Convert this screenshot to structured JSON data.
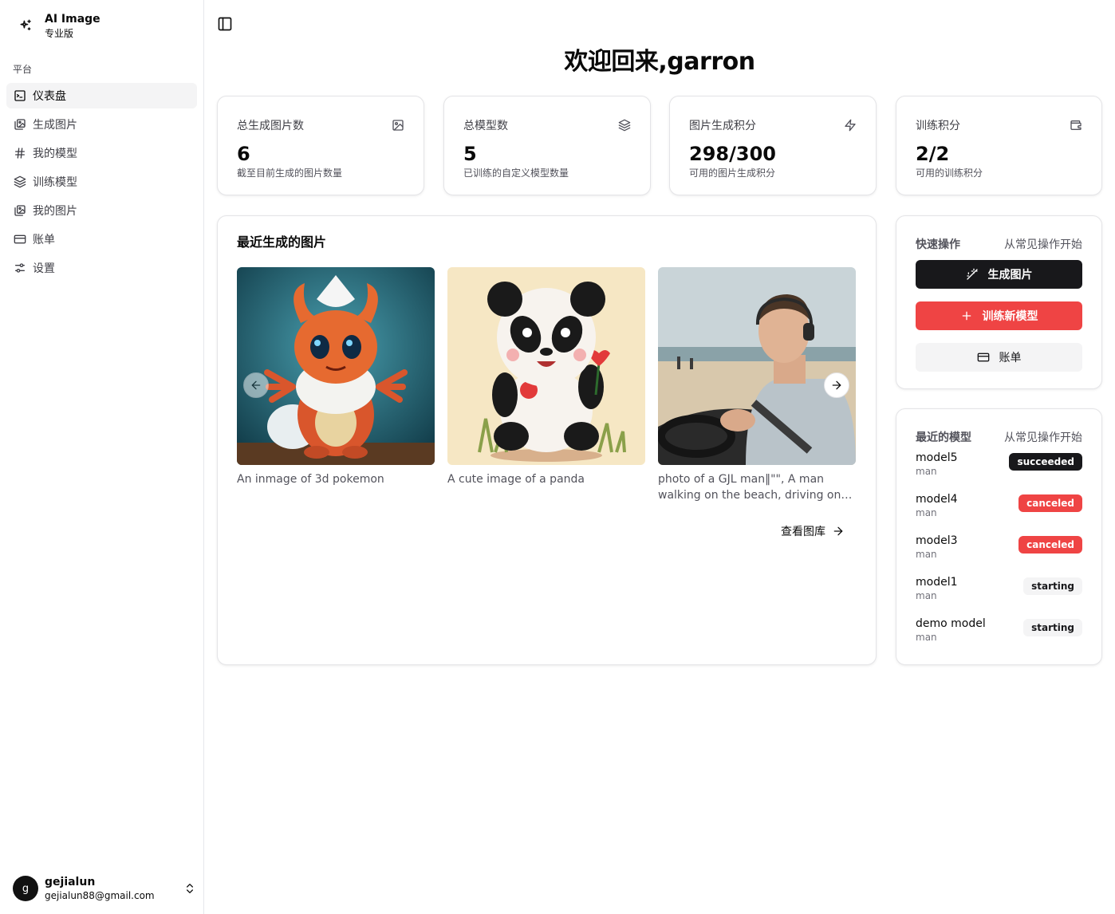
{
  "brand": {
    "title": "AI Image",
    "subtitle": "专业版"
  },
  "sidebar": {
    "group_label": "平台",
    "items": [
      {
        "label": "仪表盘",
        "icon": "terminal-icon",
        "active": true
      },
      {
        "label": "生成图片",
        "icon": "images-icon"
      },
      {
        "label": "我的模型",
        "icon": "hash-icon"
      },
      {
        "label": "训练模型",
        "icon": "layers-icon"
      },
      {
        "label": "我的图片",
        "icon": "images-icon"
      },
      {
        "label": "账单",
        "icon": "credit-card-icon"
      },
      {
        "label": "设置",
        "icon": "sliders-icon"
      }
    ]
  },
  "user": {
    "initial": "g",
    "name": "gejialun",
    "email": "gejialun88@gmail.com"
  },
  "welcome": "欢迎回来,garron",
  "stats": [
    {
      "title": "总生成图片数",
      "value": "6",
      "desc": "截至目前生成的图片数量",
      "icon": "image-icon"
    },
    {
      "title": "总模型数",
      "value": "5",
      "desc": "已训练的自定义模型数量",
      "icon": "layers-icon"
    },
    {
      "title": "图片生成积分",
      "value": "298/300",
      "desc": "可用的图片生成积分",
      "icon": "zap-icon"
    },
    {
      "title": "训练积分",
      "value": "2/2",
      "desc": "可用的训练积分",
      "icon": "wallet-icon"
    }
  ],
  "recent": {
    "title": "最近生成的图片",
    "images": [
      {
        "caption": "An inmage of 3d pokemon"
      },
      {
        "caption": "A cute image of a panda"
      },
      {
        "caption": "photo of a GJL man‖\"\", A man walking on the beach, driving on his..."
      }
    ],
    "view_all": "查看图库"
  },
  "quick": {
    "title": "快速操作",
    "subtitle": "从常见操作开始",
    "generate": "生成图片",
    "train": "训练新模型",
    "billing": "账单"
  },
  "models": {
    "title": "最近的模型",
    "subtitle": "从常见操作开始",
    "items": [
      {
        "name": "model5",
        "type": "man",
        "status": "succeeded"
      },
      {
        "name": "model4",
        "type": "man",
        "status": "canceled"
      },
      {
        "name": "model3",
        "type": "man",
        "status": "canceled"
      },
      {
        "name": "model1",
        "type": "man",
        "status": "starting"
      },
      {
        "name": "demo model",
        "type": "man",
        "status": "starting"
      }
    ]
  },
  "colors": {
    "accent_red": "#ef4444",
    "dark": "#18181b",
    "muted": "#f4f4f5"
  }
}
